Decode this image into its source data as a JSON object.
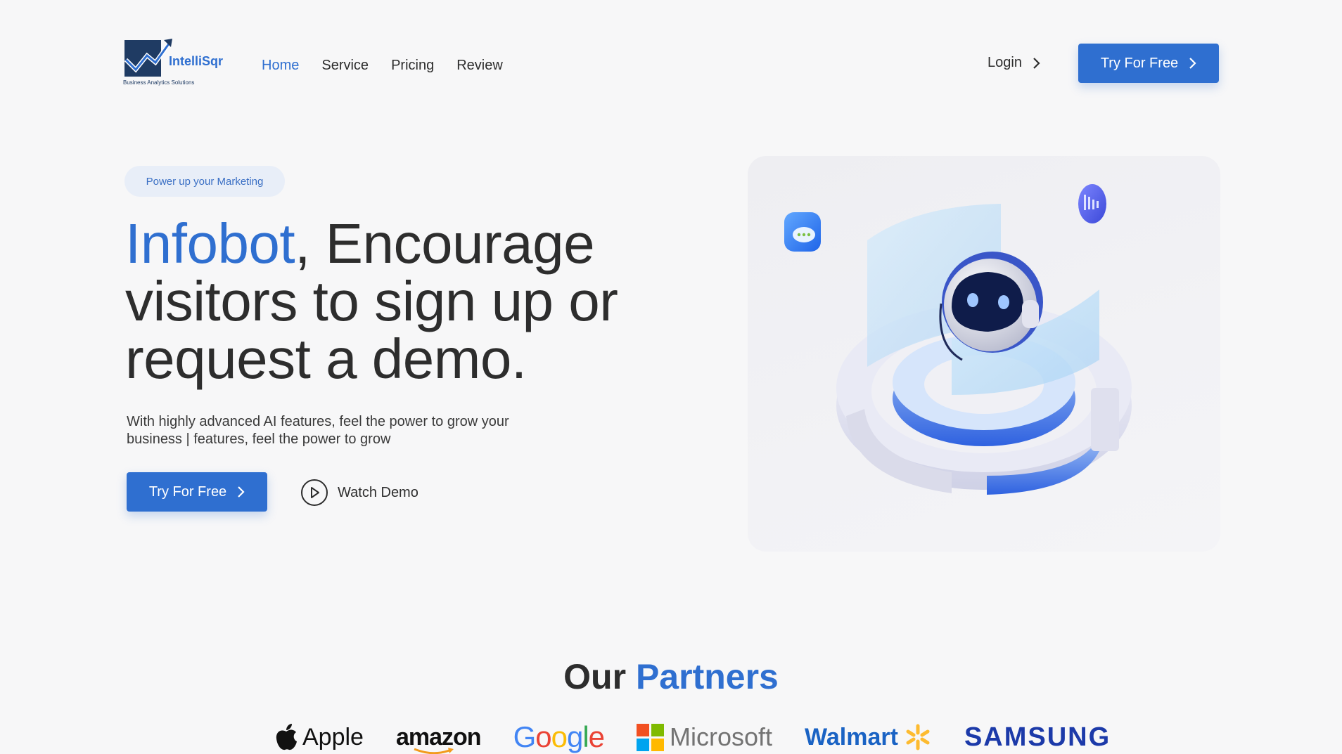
{
  "brand": {
    "name": "IntelliSqr",
    "tagline": "Business Analytics Solutions",
    "logo_icon": "chart-arrow-logo"
  },
  "nav": {
    "items": [
      {
        "label": "Home",
        "active": true
      },
      {
        "label": "Service",
        "active": false
      },
      {
        "label": "Pricing",
        "active": false
      },
      {
        "label": "Review",
        "active": false
      }
    ],
    "login_label": "Login",
    "cta_label": "Try For Free"
  },
  "hero": {
    "badge": "Power up your Marketing",
    "headline_highlight": "Infobot",
    "headline_rest": ", Encourage visitors to sign up or request a demo.",
    "subtext": "With highly advanced AI features, feel the power to grow your business | features, feel the power to grow",
    "cta_label": "Try For Free",
    "watch_label": "Watch Demo",
    "illustration_icon": "robot-assistant-illustration"
  },
  "partners": {
    "title_plain": "Our",
    "title_highlight": "Partners",
    "logos": [
      "Apple",
      "amazon",
      "Google",
      "Microsoft",
      "Walmart",
      "SAMSUNG"
    ]
  },
  "colors": {
    "accent": "#2f6fd0",
    "text": "#2d2d2d",
    "background": "#f7f7f8",
    "badge_bg": "#e8eef8"
  }
}
